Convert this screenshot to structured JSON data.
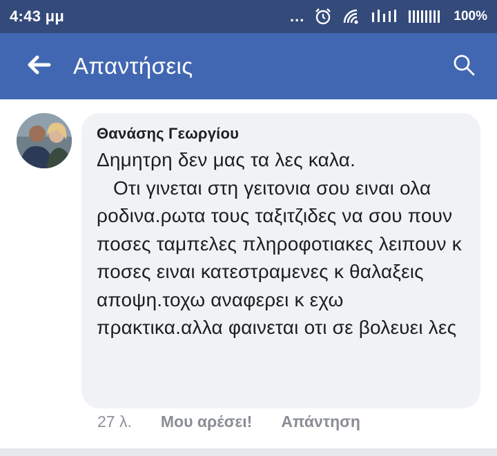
{
  "status_bar": {
    "time": "4:43 μμ",
    "overflow_dots": "...",
    "battery": "100%",
    "icons": [
      "alarm-icon",
      "wifi-icon",
      "signal-icon",
      "signal-icon",
      "battery-icon"
    ]
  },
  "app_bar": {
    "title": "Απαντήσεις",
    "back_icon": "arrow-left-icon",
    "search_icon": "search-icon"
  },
  "comment": {
    "author": "Θανάσης Γεωργίου",
    "text": "Δημητρη δεν μας τα λες καλα.\n   Οτι γινεται στη γειτονια σου ειναι ολα ροδινα.ρωτα τους ταξιτζιδες να σου πουν ποσες ταμπελες πληροφοτιακες λειπουν κ ποσες ειναι κατεστραμενες κ θαλαξεις αποψη.τοχω αναφερει κ εχω πρακτικα.αλλα φαινεται οτι σε βολευει λες",
    "age": "27 λ.",
    "like_label": "Μου αρέσει!",
    "reply_label": "Απάντηση"
  },
  "colors": {
    "status_bar": "#344a7a",
    "app_bar": "#4267b2",
    "bubble": "#f1f2f6",
    "text": "#1c1e21",
    "meta": "#8a8d93"
  }
}
